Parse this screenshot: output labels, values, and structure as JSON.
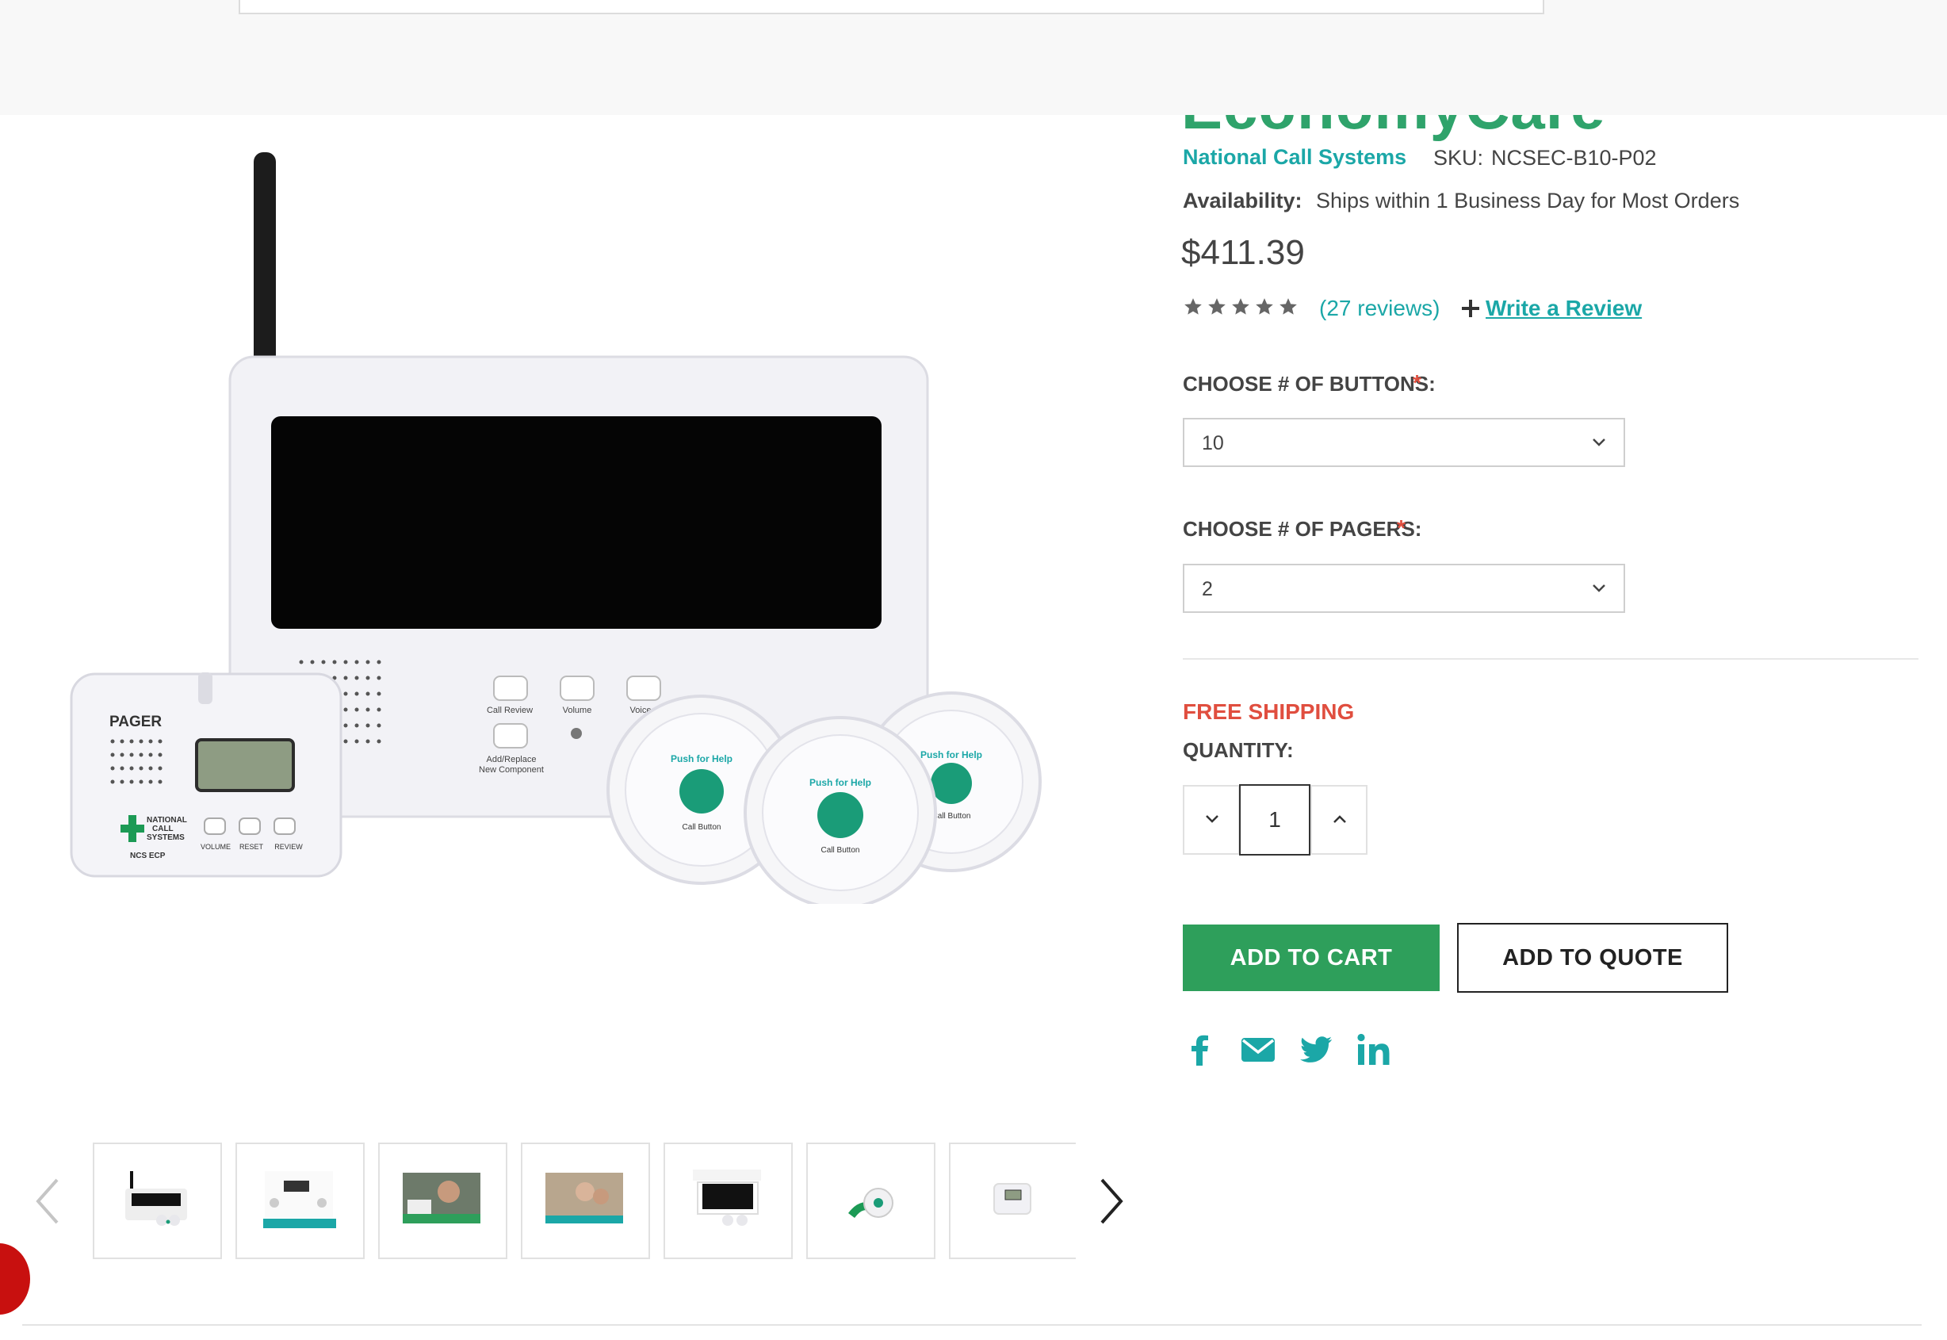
{
  "header": {
    "title_partial": "EconomyCare"
  },
  "product": {
    "brand": "National Call Systems",
    "sku_label": "SKU:",
    "sku": "NCSEC-B10-P02",
    "availability_label": "Availability:",
    "availability": "Ships within 1 Business Day for Most Orders",
    "price": "$411.39",
    "rating": 5,
    "reviews_text": "(27 reviews)",
    "write_review": "Write a Review"
  },
  "options": {
    "buttons_label": "CHOOSE # OF BUTTONS:",
    "buttons_value": "10",
    "pagers_label": "CHOOSE # OF PAGERS:",
    "pagers_value": "2",
    "required_mark": "*"
  },
  "shipping": {
    "free_shipping": "FREE SHIPPING"
  },
  "quantity": {
    "label": "QUANTITY:",
    "value": "1"
  },
  "actions": {
    "add_to_cart": "ADD TO CART",
    "add_to_quote": "ADD TO QUOTE"
  },
  "image_labels": {
    "pager": "PAGER",
    "ncs_ecp": "NCS ECP",
    "volume": "VOLUME",
    "reset": "RESET",
    "review": "REVIEW",
    "call_review": "Call Review",
    "volume_btn": "Volume",
    "voice": "Voice",
    "add_replace_1": "Add/Replace",
    "add_replace_2": "New Component",
    "push_for_help": "Push for Help",
    "call_button": "Call Button",
    "ncs_1": "NATIONAL",
    "ncs_2": "CALL",
    "ncs_3": "SYSTEMS"
  },
  "social": [
    "facebook-icon",
    "email-icon",
    "twitter-icon",
    "linkedin-icon"
  ],
  "colors": {
    "teal": "#1ba7a7",
    "green": "#2e9f5b",
    "red": "#e04e3f",
    "brand_green": "#2fa36b"
  },
  "thumbnails": [
    {
      "alt": "Base station with buttons"
    },
    {
      "alt": "System diagram"
    },
    {
      "alt": "Caregiver photo"
    },
    {
      "alt": "Family room photo"
    },
    {
      "alt": "Product sheet"
    },
    {
      "alt": "Pendant call button"
    },
    {
      "alt": "Pager device"
    }
  ]
}
